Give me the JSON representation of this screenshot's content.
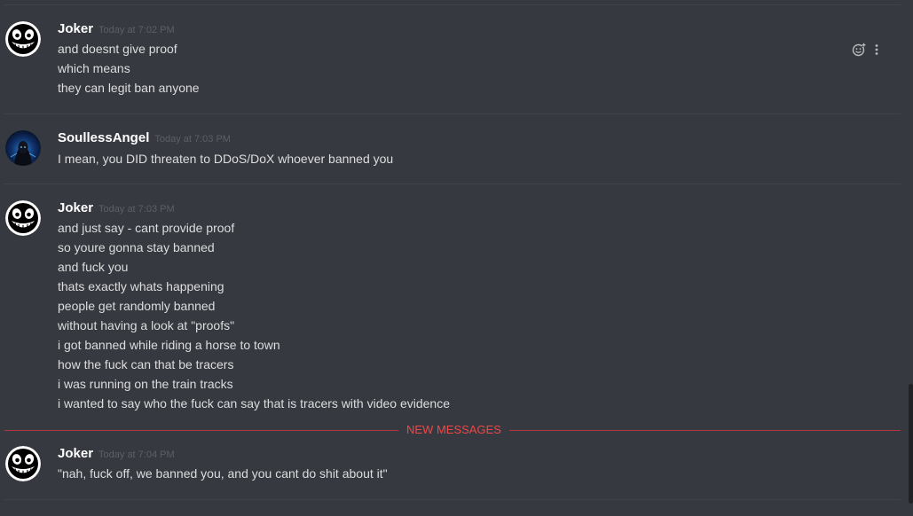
{
  "messages": [
    {
      "author": "Joker",
      "timestamp": "Today at 7:02 PM",
      "avatar_icon": "smiling-skull-icon",
      "lines": [
        "and doesnt give proof",
        "which means",
        "they can legit ban anyone"
      ]
    },
    {
      "author": "SoullessAngel",
      "timestamp": "Today at 7:03 PM",
      "avatar_icon": "dark-hooded-figure-avatar",
      "lines": [
        "I mean, you DID threaten to DDoS/DoX whoever banned you"
      ]
    },
    {
      "author": "Joker",
      "timestamp": "Today at 7:03 PM",
      "avatar_icon": "smiling-skull-icon",
      "lines": [
        "and just say - cant provide proof",
        "so youre gonna stay banned",
        "and fuck you",
        "thats exactly whats happening",
        "people get randomly banned",
        "without having a look at \"proofs\"",
        "i got banned while riding a horse to town",
        "how the fuck can that be tracers",
        "i was running on the train tracks",
        "i wanted to say who the fuck can say that is tracers with video evidence"
      ]
    },
    {
      "author": "Joker",
      "timestamp": "Today at 7:04 PM",
      "avatar_icon": "smiling-skull-icon",
      "lines": [
        "\"nah, fuck off, we banned you, and you cant do shit about it\""
      ]
    }
  ],
  "new_messages_label": "NEW MESSAGES",
  "hover_actions": [
    {
      "name": "add-reaction-icon"
    },
    {
      "name": "more-options-icon"
    }
  ],
  "colors": {
    "background": "#36393f",
    "username": "#ffffff",
    "message_text": "#dcddde",
    "timestamp": "#5c5f64",
    "new_messages_accent": "#f04747"
  }
}
